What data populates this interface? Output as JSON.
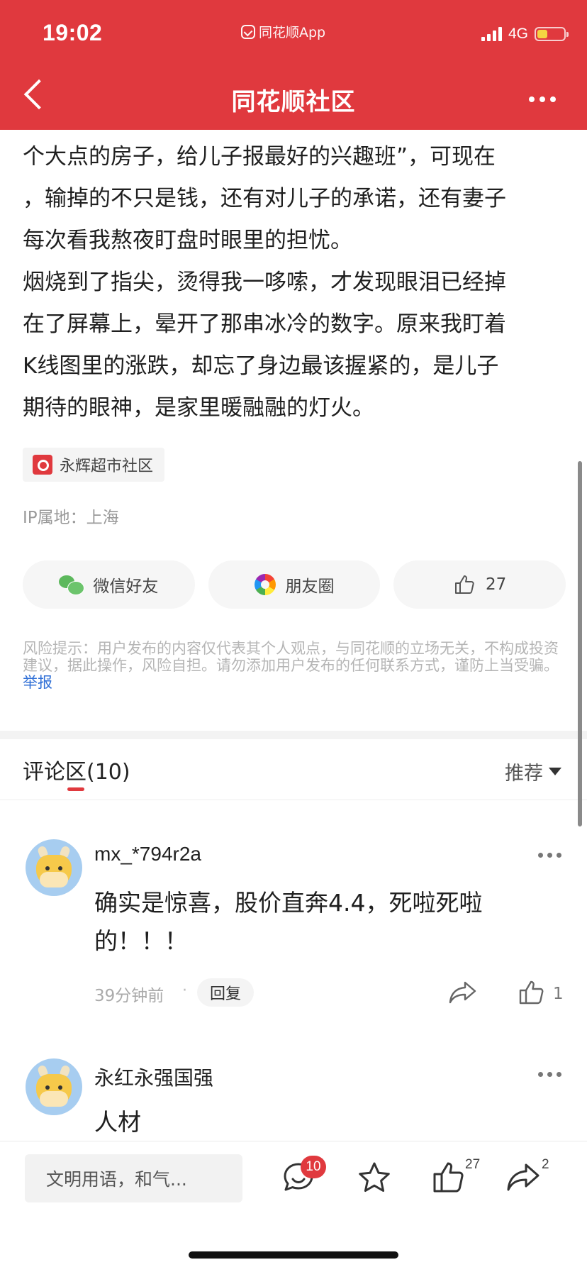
{
  "status_bar": {
    "time": "19:02",
    "app_name": "同花顺App",
    "network": "4G",
    "battery_percent": 40,
    "battery_color": "#f5d442"
  },
  "nav": {
    "title": "同花顺社区",
    "back_icon": "chevron-left-icon",
    "more_icon": "more-horizontal-icon"
  },
  "theme": {
    "brand_red": "#e0393e",
    "link_blue": "#2f6fd6"
  },
  "article": {
    "lines": [
      "个大点的房子，给儿子报最好的兴趣班”，可现在",
      "，输掉的不只是钱，还有对儿子的承诺，还有妻子",
      "每次看我熬夜盯盘时眼里的担忧。",
      "烟烧到了指尖，烫得我一哆嗦，才发现眼泪已经掉",
      "在了屏幕上，晕开了那串冰冷的数字。原来我盯着",
      "K线图里的涨跌，却忘了身边最该握紧的，是儿子",
      "期待的眼神，是家里暖融融的灯火。"
    ],
    "tag": "永辉超市社区",
    "ip_location": "IP属地：上海"
  },
  "share": {
    "wechat_label": "微信好友",
    "moments_label": "朋友圈",
    "like_count": "27"
  },
  "risk": {
    "text": "风险提示：用户发布的内容仅代表其个人观点，与同花顺的立场无关，不构成投资建议，据此操作，风险自担。请勿添加用户发布的任何联系方式，谨防上当受骗。",
    "report_link": "举报"
  },
  "comments_section": {
    "title": "评论区(10)",
    "sort_label": "推荐"
  },
  "comments": [
    {
      "username": "mx_*794r2a",
      "text": "确实是惊喜，股价直奔4.4，死啦死啦的！！！",
      "time": "39分钟前",
      "reply_label": "回复",
      "like_count": "1"
    },
    {
      "username": "永红永强国强",
      "text": "人材"
    }
  ],
  "bottom_bar": {
    "input_placeholder": "文明用语，和气...",
    "comment_badge": "10",
    "like_count": "27",
    "share_count": "2"
  }
}
